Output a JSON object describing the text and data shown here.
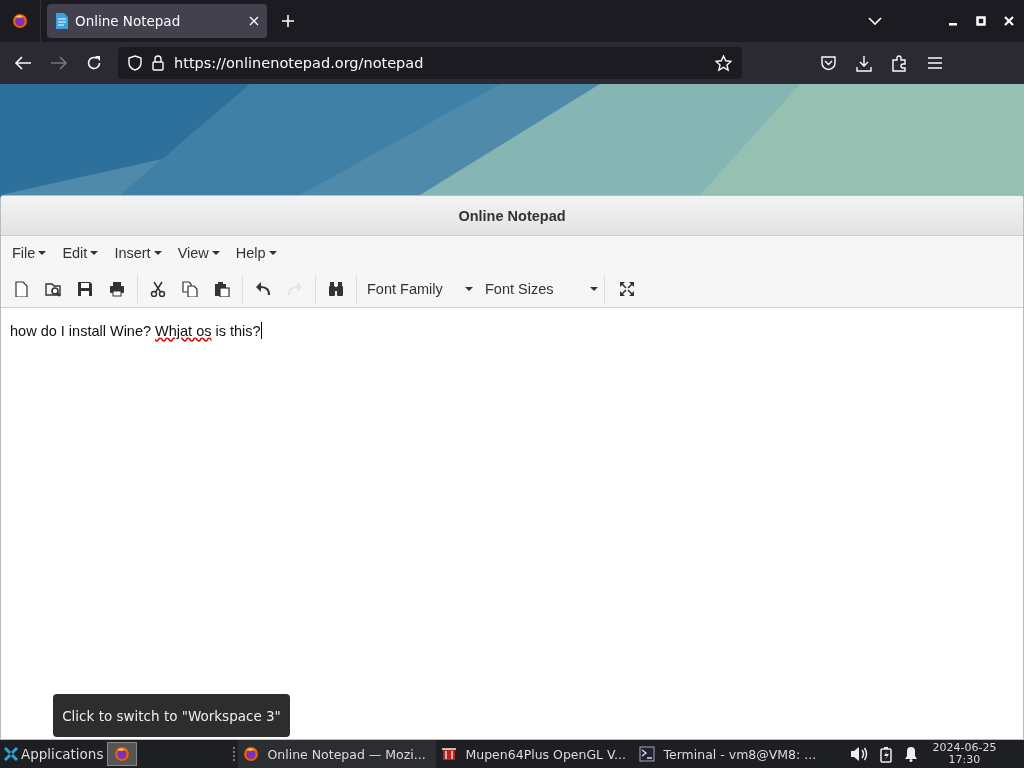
{
  "browser": {
    "tabs": [
      {
        "title": "Online Notepad",
        "selected": true
      }
    ],
    "url": "https://onlinenotepad.org/notepad"
  },
  "notepad": {
    "title": "Online Notepad",
    "menus": [
      "File",
      "Edit",
      "Insert",
      "View",
      "Help"
    ],
    "toolbar": [
      [
        {
          "kind": "new",
          "disabled": false
        },
        {
          "kind": "preview",
          "disabled": false
        },
        {
          "kind": "save",
          "disabled": false
        },
        {
          "kind": "print",
          "disabled": false
        }
      ],
      [
        {
          "kind": "cut",
          "disabled": false
        },
        {
          "kind": "copy",
          "disabled": false
        },
        {
          "kind": "paste",
          "disabled": false
        }
      ],
      [
        {
          "kind": "undo",
          "disabled": false
        },
        {
          "kind": "redo",
          "disabled": true
        }
      ],
      [
        {
          "kind": "find",
          "disabled": false
        }
      ]
    ],
    "font_family": "Font Family",
    "font_sizes": "Font Sizes",
    "text_before": "how do I install Wine? ",
    "text_misspelled": "Whjat os",
    "text_after": " is this?"
  },
  "tooltip": "Click to switch to \"Workspace 3\"",
  "taskbar": {
    "applications": "Applications",
    "tasks": [
      {
        "label": "Online Notepad — Mozi...",
        "kind": "firefox",
        "selected": true
      },
      {
        "label": "Mupen64Plus OpenGL V...",
        "kind": "game",
        "selected": false
      },
      {
        "label": "Terminal - vm8@VM8: ...",
        "kind": "terminal",
        "selected": false
      }
    ],
    "date": "2024-06-25",
    "time": "17:30"
  }
}
